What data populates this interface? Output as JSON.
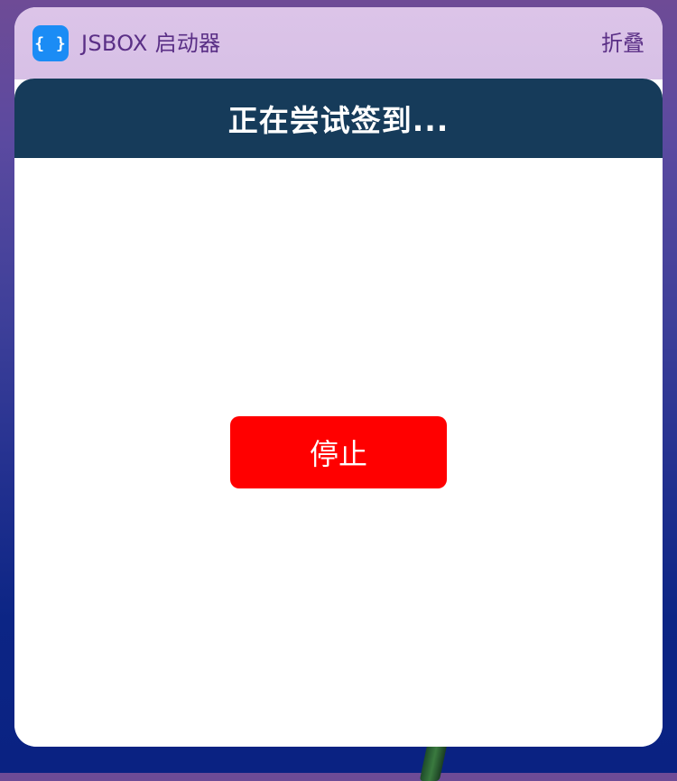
{
  "widget": {
    "app_icon_glyph": "{ }",
    "app_title": "JSBOX 启动器",
    "collapse_label": "折叠"
  },
  "sheet": {
    "title": "正在尝试签到..."
  },
  "actions": {
    "stop_label": "停止"
  },
  "colors": {
    "app_icon": "#1b8cf5",
    "nav_bar": "#163b5a",
    "stop_button": "#ff0000",
    "header_text": "#5a2f86"
  }
}
